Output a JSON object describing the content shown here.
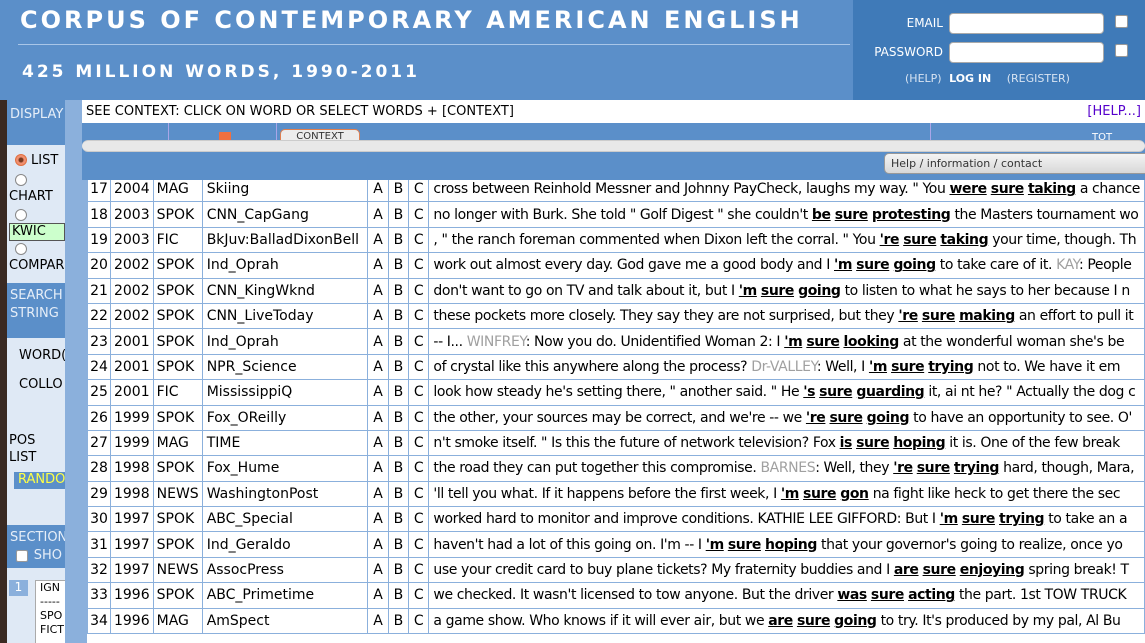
{
  "header": {
    "title": "CORPUS OF CONTEMPORARY AMERICAN ENGLISH",
    "subtitle": "425 MILLION WORDS, 1990-2011"
  },
  "login": {
    "email_label": "EMAIL",
    "password_label": "PASSWORD",
    "help": "(HELP)",
    "login": "LOG IN",
    "register": "(REGISTER)"
  },
  "sidebar": {
    "display": "DISPLAY",
    "list": "LIST",
    "chart": "CHART",
    "kwic": "KWIC",
    "compare": "COMPAR",
    "search_string": "SEARCH STRING",
    "word": "WORD(",
    "collocates": "COLLO",
    "pos_list": "POS LIST",
    "random": "RANDO",
    "sections": "SECTION",
    "show": "SHO",
    "section_num": "1",
    "list_items": [
      "IGN",
      "-----",
      "SPO",
      "FICT"
    ]
  },
  "context_bar": {
    "instruction": "SEE CONTEXT: CLICK ON WORD OR SELECT WORDS + [CONTEXT]",
    "help": "[HELP...]",
    "context_button": "CONTEXT",
    "tot": "TOT",
    "help_info": "Help / information / contact"
  },
  "colors": {
    "header_blue": "#5b8fc9",
    "login_blue": "#3f7ab8",
    "speaker_gray": "#a0a0a0",
    "help_link": "#5500cc"
  },
  "rows": [
    {
      "n": "17",
      "year": "2004",
      "genre": "MAG",
      "source": "Skiing",
      "a": "A",
      "b": "B",
      "c": "C",
      "text": [
        [
          "cross between Reinhold Messner and Johnny PayCheck, laughs my way. \" You ",
          ""
        ],
        [
          "were",
          "kw"
        ],
        [
          " ",
          ""
        ],
        [
          "sure",
          "kw"
        ],
        [
          " ",
          ""
        ],
        [
          "taking",
          "kw"
        ],
        [
          " a chance",
          ""
        ]
      ]
    },
    {
      "n": "18",
      "year": "2003",
      "genre": "SPOK",
      "source": "CNN_CapGang",
      "a": "A",
      "b": "B",
      "c": "C",
      "text": [
        [
          "no longer with Burk. She told \" Golf Digest \" she couldn't ",
          ""
        ],
        [
          "be",
          "kw"
        ],
        [
          " ",
          ""
        ],
        [
          "sure",
          "kw"
        ],
        [
          " ",
          ""
        ],
        [
          "protesting",
          "kw"
        ],
        [
          " the Masters tournament wo",
          ""
        ]
      ]
    },
    {
      "n": "19",
      "year": "2003",
      "genre": "FIC",
      "source": "BkJuv:BalladDixonBell",
      "a": "A",
      "b": "B",
      "c": "C",
      "text": [
        [
          ", \" the ranch foreman commented when Dixon left the corral. \" You ",
          ""
        ],
        [
          "'re",
          "kw"
        ],
        [
          " ",
          ""
        ],
        [
          "sure",
          "kw"
        ],
        [
          " ",
          ""
        ],
        [
          "taking",
          "kw"
        ],
        [
          " your time, though. Th",
          ""
        ]
      ]
    },
    {
      "n": "20",
      "year": "2002",
      "genre": "SPOK",
      "source": "Ind_Oprah",
      "a": "A",
      "b": "B",
      "c": "C",
      "text": [
        [
          "work out almost every day. God gave me a good body and I ",
          ""
        ],
        [
          "'m",
          "kw"
        ],
        [
          " ",
          ""
        ],
        [
          "sure",
          "kw"
        ],
        [
          " ",
          ""
        ],
        [
          "going",
          "kw"
        ],
        [
          " to take care of it. ",
          ""
        ],
        [
          "KAY",
          "spk"
        ],
        [
          ": People",
          ""
        ]
      ]
    },
    {
      "n": "21",
      "year": "2002",
      "genre": "SPOK",
      "source": "CNN_KingWknd",
      "a": "A",
      "b": "B",
      "c": "C",
      "text": [
        [
          "don't want to go on TV and talk about it, but I ",
          ""
        ],
        [
          "'m",
          "kw"
        ],
        [
          " ",
          ""
        ],
        [
          "sure",
          "kw"
        ],
        [
          " ",
          ""
        ],
        [
          "going",
          "kw"
        ],
        [
          " to listen to what he says to her because I n",
          ""
        ]
      ]
    },
    {
      "n": "22",
      "year": "2002",
      "genre": "SPOK",
      "source": "CNN_LiveToday",
      "a": "A",
      "b": "B",
      "c": "C",
      "text": [
        [
          "these pockets more closely. They say they are not surprised, but they ",
          ""
        ],
        [
          "'re",
          "kw"
        ],
        [
          " ",
          ""
        ],
        [
          "sure",
          "kw"
        ],
        [
          " ",
          ""
        ],
        [
          "making",
          "kw"
        ],
        [
          " an effort to pull it",
          ""
        ]
      ]
    },
    {
      "n": "23",
      "year": "2001",
      "genre": "SPOK",
      "source": "Ind_Oprah",
      "a": "A",
      "b": "B",
      "c": "C",
      "text": [
        [
          "-- I... ",
          ""
        ],
        [
          "WINFREY",
          "spk"
        ],
        [
          ": Now you do. Unidentified Woman 2: I ",
          ""
        ],
        [
          "'m",
          "kw"
        ],
        [
          " ",
          ""
        ],
        [
          "sure",
          "kw"
        ],
        [
          " ",
          ""
        ],
        [
          "looking",
          "kw"
        ],
        [
          " at the wonderful woman she's be",
          ""
        ]
      ]
    },
    {
      "n": "24",
      "year": "2001",
      "genre": "SPOK",
      "source": "NPR_Science",
      "a": "A",
      "b": "B",
      "c": "C",
      "text": [
        [
          "of crystal like this anywhere along the process? ",
          ""
        ],
        [
          "Dr-VALLEY",
          "spk"
        ],
        [
          ": Well, I ",
          ""
        ],
        [
          "'m",
          "kw"
        ],
        [
          " ",
          ""
        ],
        [
          "sure",
          "kw"
        ],
        [
          " ",
          ""
        ],
        [
          "trying",
          "kw"
        ],
        [
          " not to. We have it em",
          ""
        ]
      ]
    },
    {
      "n": "25",
      "year": "2001",
      "genre": "FIC",
      "source": "MississippiQ",
      "a": "A",
      "b": "B",
      "c": "C",
      "text": [
        [
          "look how steady he's setting there, \" another said. \" He ",
          ""
        ],
        [
          "'s",
          "kw"
        ],
        [
          " ",
          ""
        ],
        [
          "sure",
          "kw"
        ],
        [
          " ",
          ""
        ],
        [
          "guarding",
          "kw"
        ],
        [
          " it, ai nt he? \" Actually the dog c",
          ""
        ]
      ]
    },
    {
      "n": "26",
      "year": "1999",
      "genre": "SPOK",
      "source": "Fox_OReilly",
      "a": "A",
      "b": "B",
      "c": "C",
      "text": [
        [
          "the other, your sources may be correct, and we're -- we ",
          ""
        ],
        [
          "'re",
          "kw"
        ],
        [
          " ",
          ""
        ],
        [
          "sure",
          "kw"
        ],
        [
          " ",
          ""
        ],
        [
          "going",
          "kw"
        ],
        [
          " to have an opportunity to see. O'",
          ""
        ]
      ]
    },
    {
      "n": "27",
      "year": "1999",
      "genre": "MAG",
      "source": "TIME",
      "a": "A",
      "b": "B",
      "c": "C",
      "text": [
        [
          "n't smoke itself. \" Is this the future of network television? Fox ",
          ""
        ],
        [
          "is",
          "kw"
        ],
        [
          " ",
          ""
        ],
        [
          "sure",
          "kw"
        ],
        [
          " ",
          ""
        ],
        [
          "hoping",
          "kw"
        ],
        [
          " it is. One of the few break",
          ""
        ]
      ]
    },
    {
      "n": "28",
      "year": "1998",
      "genre": "SPOK",
      "source": "Fox_Hume",
      "a": "A",
      "b": "B",
      "c": "C",
      "text": [
        [
          "the road they can put together this compromise. ",
          ""
        ],
        [
          "BARNES",
          "spk"
        ],
        [
          ": Well, they ",
          ""
        ],
        [
          "'re",
          "kw"
        ],
        [
          " ",
          ""
        ],
        [
          "sure",
          "kw"
        ],
        [
          " ",
          ""
        ],
        [
          "trying",
          "kw"
        ],
        [
          " hard, though, Mara,",
          ""
        ]
      ]
    },
    {
      "n": "29",
      "year": "1998",
      "genre": "NEWS",
      "source": "WashingtonPost",
      "a": "A",
      "b": "B",
      "c": "C",
      "text": [
        [
          "'ll tell you what. If it happens before the first week, I ",
          ""
        ],
        [
          "'m",
          "kw"
        ],
        [
          " ",
          ""
        ],
        [
          "sure",
          "kw"
        ],
        [
          " ",
          ""
        ],
        [
          "gon",
          "kw"
        ],
        [
          " na fight like heck to get there the sec",
          ""
        ]
      ]
    },
    {
      "n": "30",
      "year": "1997",
      "genre": "SPOK",
      "source": "ABC_Special",
      "a": "A",
      "b": "B",
      "c": "C",
      "text": [
        [
          "worked hard to monitor and improve conditions. KATHIE LEE GIFFORD: But I ",
          ""
        ],
        [
          "'m",
          "kw"
        ],
        [
          " ",
          ""
        ],
        [
          "sure",
          "kw"
        ],
        [
          " ",
          ""
        ],
        [
          "trying",
          "kw"
        ],
        [
          " to take an a",
          ""
        ]
      ]
    },
    {
      "n": "31",
      "year": "1997",
      "genre": "SPOK",
      "source": "Ind_Geraldo",
      "a": "A",
      "b": "B",
      "c": "C",
      "text": [
        [
          "haven't had a lot of this going on. I'm -- I ",
          ""
        ],
        [
          "'m",
          "kw"
        ],
        [
          " ",
          ""
        ],
        [
          "sure",
          "kw"
        ],
        [
          " ",
          ""
        ],
        [
          "hoping",
          "kw"
        ],
        [
          " that your governor's going to realize, once yo",
          ""
        ]
      ]
    },
    {
      "n": "32",
      "year": "1997",
      "genre": "NEWS",
      "source": "AssocPress",
      "a": "A",
      "b": "B",
      "c": "C",
      "text": [
        [
          "use your credit card to buy plane tickets? My fraternity buddies and I ",
          ""
        ],
        [
          "are",
          "kw"
        ],
        [
          " ",
          ""
        ],
        [
          "sure",
          "kw"
        ],
        [
          " ",
          ""
        ],
        [
          "enjoying",
          "kw"
        ],
        [
          " spring break! T",
          ""
        ]
      ]
    },
    {
      "n": "33",
      "year": "1996",
      "genre": "SPOK",
      "source": "ABC_Primetime",
      "a": "A",
      "b": "B",
      "c": "C",
      "text": [
        [
          "we checked. It wasn't licensed to tow anyone. But the driver ",
          ""
        ],
        [
          "was",
          "kw"
        ],
        [
          " ",
          ""
        ],
        [
          "sure",
          "kw"
        ],
        [
          " ",
          ""
        ],
        [
          "acting",
          "kw"
        ],
        [
          " the part. 1st TOW TRUCK",
          ""
        ]
      ]
    },
    {
      "n": "34",
      "year": "1996",
      "genre": "MAG",
      "source": "AmSpect",
      "a": "A",
      "b": "B",
      "c": "C",
      "text": [
        [
          "a game show. Who knows if it will ever air, but we ",
          ""
        ],
        [
          "are",
          "kw"
        ],
        [
          " ",
          ""
        ],
        [
          "sure",
          "kw"
        ],
        [
          " ",
          ""
        ],
        [
          "going",
          "kw"
        ],
        [
          " to try. It's produced by my pal, Al Bu",
          ""
        ]
      ]
    }
  ]
}
